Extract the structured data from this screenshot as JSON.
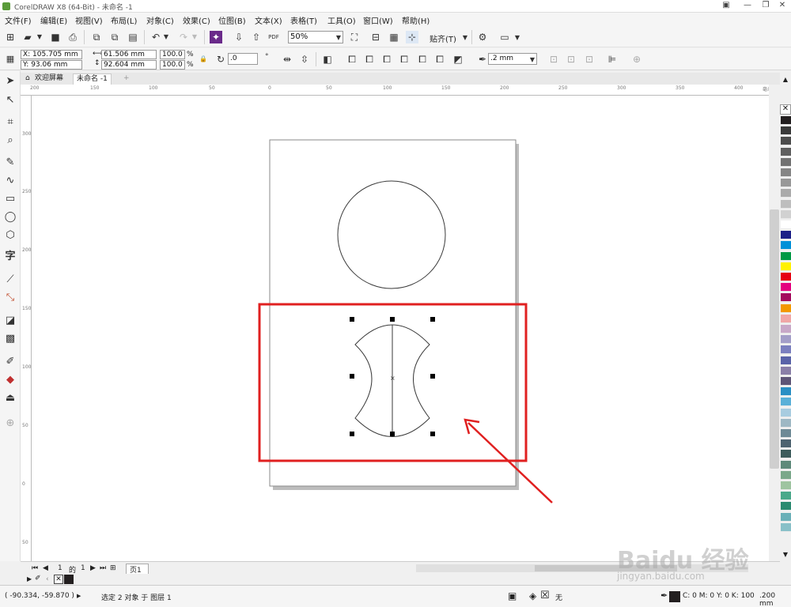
{
  "window": {
    "title": "CorelDRAW X8 (64-Bit) - 未命名 -1"
  },
  "menu": [
    "文件(F)",
    "编辑(E)",
    "视图(V)",
    "布局(L)",
    "对象(C)",
    "效果(C)",
    "位图(B)",
    "文本(X)",
    "表格(T)",
    "工具(O)",
    "窗口(W)",
    "帮助(H)"
  ],
  "toolbar": {
    "zoom": "50%",
    "snap_label": "贴齐(T)",
    "pdf_label": "PDF"
  },
  "properties": {
    "x": "X: 105.705 mm",
    "y": "Y: 93.06 mm",
    "width": "61.506 mm",
    "height": "92.604 mm",
    "scale_x": "100.0",
    "scale_y": "100.0",
    "percent": "%",
    "rotation": ".0",
    "outline_width": ".2 mm"
  },
  "tabs": [
    {
      "label": "欢迎屏幕"
    },
    {
      "label": "未命名 -1"
    }
  ],
  "rulers": {
    "h_ticks": [
      "200",
      "150",
      "100",
      "50",
      "0",
      "50",
      "100",
      "150",
      "200",
      "250",
      "300",
      "350",
      "400"
    ],
    "v_ticks": [
      "300",
      "250",
      "200",
      "150",
      "100",
      "50",
      "0",
      "50"
    ],
    "unit": "毫米"
  },
  "page_nav": {
    "page_counter_current": "1",
    "page_counter_of": "的",
    "page_counter_total": "1",
    "page_tab": "页1"
  },
  "status": {
    "coords": "( -90.334, -59.870 )",
    "selection": "选定 2 对象 于 图层 1",
    "fill_none": "无",
    "color_info": "C: 0 M: 0 Y: 0 K: 100",
    "outline_info": ".200 mm"
  },
  "watermark": {
    "brand": "Baidu 经验",
    "url": "jingyan.baidu.com"
  },
  "colors": {
    "annotation_red": "#e02020",
    "palette": [
      "#231f20",
      "#3a3a3a",
      "#4d4d4d",
      "#5f5f5f",
      "#727272",
      "#858585",
      "#989898",
      "#ababab",
      "#bebebe",
      "#d1d1d1",
      "#ffffff",
      "#1d2088",
      "#0090d8",
      "#009944",
      "#fff100",
      "#e60012",
      "#e4007f",
      "#a40b5d",
      "#f39800",
      "#f0a6a6",
      "#c8a8c8",
      "#a39ec8",
      "#7b7fbf",
      "#5a63a8",
      "#8a7fa8",
      "#5e5577",
      "#2a8fc4",
      "#5ab0d8",
      "#a8cce0",
      "#9eb8c4",
      "#6e8a96",
      "#4d6370",
      "#3d5c5c",
      "#5e8a7a",
      "#7aa88a",
      "#9ec4a0",
      "#4aa88a",
      "#2a8a70",
      "#6ab0b8",
      "#88c0c8"
    ]
  }
}
